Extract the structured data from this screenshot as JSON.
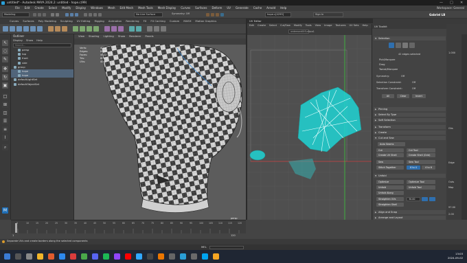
{
  "titlebar": {
    "title": "untitled* - Autodesk MAYA 2024.2: untitled - hope.c(99)",
    "minimize": "—",
    "maximize": "□",
    "close": "✕"
  },
  "menubar": {
    "items": [
      "File",
      "Edit",
      "Create",
      "Select",
      "Modify",
      "Display",
      "Windows",
      "Mesh",
      "Edit Mesh",
      "Mesh Tools",
      "Mesh Display",
      "Curves",
      "Surfaces",
      "Deform",
      "UV",
      "Generate",
      "Cache",
      "Arnold",
      "Help"
    ],
    "workspace": "Workspace: General"
  },
  "statusline": {
    "mode": "Modeling",
    "surface": "No Live Surface",
    "symmetry": "Symmetry: Off",
    "object_field": "hope.c[4299]",
    "sign_in": "Sign In",
    "user": "Gabriel LB"
  },
  "shelf": {
    "tabs": [
      "Curves",
      "Surfaces",
      "Poly Modeling",
      "Sculpting",
      "UV Editing",
      "Rigging",
      "Animation",
      "Rendering",
      "FX",
      "FX Caching",
      "Custom",
      "MASH",
      "Motion Graphics"
    ]
  },
  "outliner": {
    "title": "Outliner",
    "menus": [
      "Display",
      "Show",
      "Help"
    ],
    "search_placeholder": "Search...",
    "rows": [
      {
        "label": "persp",
        "indent": 1,
        "selected": false
      },
      {
        "label": "top",
        "indent": 1,
        "selected": false
      },
      {
        "label": "front",
        "indent": 1,
        "selected": false
      },
      {
        "label": "side",
        "indent": 1,
        "selected": false
      },
      {
        "label": "group",
        "indent": 0,
        "selected": false
      },
      {
        "label": "hope",
        "indent": 1,
        "selected": true
      },
      {
        "label": "hope",
        "indent": 1,
        "selected": true
      },
      {
        "label": "defaultLightSet",
        "indent": 0,
        "selected": false
      },
      {
        "label": "defaultObjectSet",
        "indent": 0,
        "selected": false
      }
    ]
  },
  "viewport": {
    "menus": [
      "View",
      "Shading",
      "Lighting",
      "Show",
      "Renderer",
      "Panels"
    ],
    "hud": [
      {
        "label": "Verts:",
        "value": "4010"
      },
      {
        "label": "Edges:",
        "value": "8032"
      },
      {
        "label": "Faces:",
        "value": "4022"
      },
      {
        "label": "Tris:",
        "value": "8000"
      },
      {
        "label": "UVs:",
        "value": "4065"
      }
    ],
    "camera": "persp"
  },
  "uveditor": {
    "title": "UV Editor",
    "menus": [
      "Edit",
      "Create",
      "Select",
      "Cut/Sew",
      "Modify",
      "Tools",
      "View",
      "Image",
      "Textures",
      "UV Sets",
      "Help"
    ],
    "field": "ondemandUtSurface1"
  },
  "toolkit": {
    "title": "UV Toolkit",
    "selection_header": "Selection",
    "edges_selected": "42 edges selected",
    "options": [
      "Pick/Marquee",
      "Drag",
      "Tweak/Marquee"
    ],
    "symmetry_label": "Symmetry:",
    "symmetry_value": "Off",
    "sel_constraint_label": "Selection Constraint:",
    "sel_constraint_value": "Off",
    "transform_constraint_label": "Transform Constraint:",
    "transform_constraint_value": "Off",
    "btn_all": "All",
    "btn_clear": "Clear",
    "btn_invert": "Invert",
    "sections": [
      "Pinning",
      "Select By Type",
      "Soft Selection",
      "Transform",
      "Create",
      "Cut and Sew",
      "Unfold",
      "Align and Snap",
      "Arrange and Layout"
    ],
    "cut_sew": {
      "auto_seams": "Auto Seams",
      "cut": "Cut",
      "cut_tool": "Cut Tool",
      "create_uv_shell": "Create UV Shell",
      "create_shell_grid": "Create Shell (Grid)",
      "sew": "Sew",
      "sew_tool": "Sew Tool",
      "stitch_together": "Stitch Together",
      "stitch_btn": "6 to 4",
      "stitch_btn2": "4 to 6"
    },
    "unfold": {
      "optimize": "Optimize",
      "optimize_tool": "Optimize Tool",
      "unfold": "Unfold",
      "unfold_tool": "Unfold Tool",
      "unfold_along": "Unfold Along",
      "straighten_uvs": "Straighten UVs",
      "straighten_value": "30.00",
      "straighten_shell": "Straighten Shell"
    }
  },
  "rightstrip": {
    "values": [
      "1.000",
      "Ghs",
      "Edge",
      "Outs",
      "Map",
      "97.00",
      "2.00"
    ]
  },
  "timeline": {
    "ticks": [
      "5",
      "10",
      "15",
      "20",
      "25",
      "30",
      "35",
      "40",
      "45",
      "50",
      "55",
      "60",
      "65",
      "70",
      "75",
      "80",
      "85",
      "90",
      "95",
      "100",
      "105",
      "110",
      "115",
      "120"
    ],
    "start": "1",
    "end": "120"
  },
  "helpline": {
    "text": "Separate UVs and create borders along the selected components"
  },
  "cmdline": {
    "label": "MEL"
  },
  "taskbar": {
    "time": "13:03",
    "date": "2024-09-02"
  },
  "colors": {
    "uv_shell": "#20d4d4",
    "selection_blue": "#2f6fae",
    "checker_light": "#d8d8d8",
    "checker_dark": "#3a3a3a"
  }
}
